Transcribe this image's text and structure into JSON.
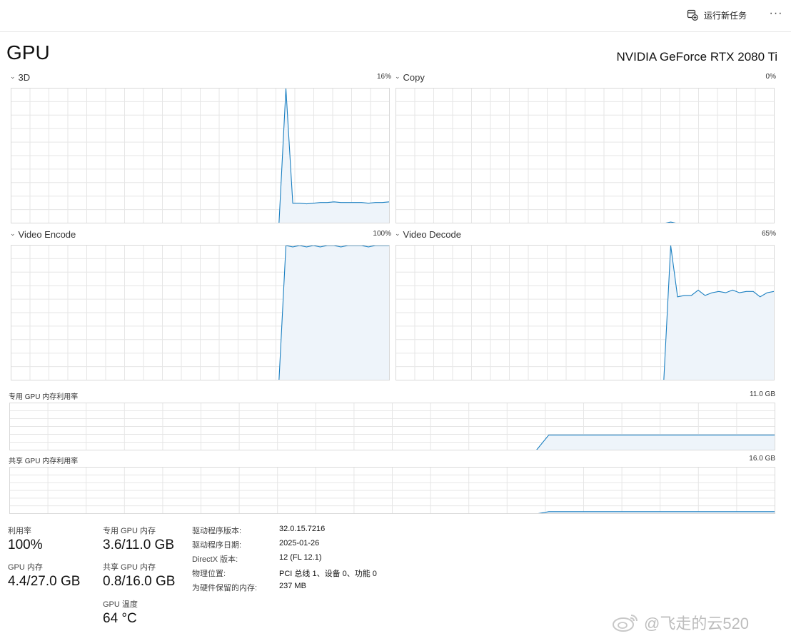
{
  "toolbar": {
    "run_task_label": "运行新任务",
    "run_task_icon": "run-task-icon",
    "more_icon": "more-icon",
    "more_glyph": "···"
  },
  "header": {
    "title": "GPU",
    "model": "NVIDIA GeForce RTX 2080 Ti"
  },
  "engines": [
    {
      "label": "3D",
      "percent": "16%"
    },
    {
      "label": "Copy",
      "percent": "0%"
    },
    {
      "label": "Video Encode",
      "percent": "100%"
    },
    {
      "label": "Video Decode",
      "percent": "65%"
    }
  ],
  "memory_graphs": [
    {
      "label": "专用 GPU 内存利用率",
      "max": "11.0 GB"
    },
    {
      "label": "共享 GPU 内存利用率",
      "max": "16.0 GB"
    }
  ],
  "stats": {
    "utilization_label": "利用率",
    "utilization_value": "100%",
    "gpu_memory_label": "GPU 内存",
    "gpu_memory_value": "4.4/27.0 GB",
    "dedicated_label": "专用 GPU 内存",
    "dedicated_value": "3.6/11.0 GB",
    "shared_label": "共享 GPU 内存",
    "shared_value": "0.8/16.0 GB",
    "temp_label": "GPU 温度",
    "temp_value": "64 °C"
  },
  "info": {
    "driver_version_key": "驱动程序版本:",
    "driver_version_val": "32.0.15.7216",
    "driver_date_key": "驱动程序日期:",
    "driver_date_val": "2025-01-26",
    "directx_key": "DirectX 版本:",
    "directx_val": "12 (FL 12.1)",
    "location_key": "物理位置:",
    "location_val": "PCI 总线 1、设备 0、功能 0",
    "reserved_key": "为硬件保留的内存:",
    "reserved_val": "237 MB"
  },
  "watermark": {
    "text": "@飞走的云520"
  },
  "colors": {
    "line": "#1a7fc1",
    "fill": "#eef4fa",
    "grid": "#e6e6e6"
  },
  "chart_data": [
    {
      "type": "area",
      "name_ref": "3D",
      "ylim": [
        0,
        100
      ],
      "values": [
        0,
        0,
        0,
        0,
        0,
        0,
        0,
        0,
        0,
        0,
        0,
        0,
        0,
        0,
        0,
        0,
        0,
        0,
        0,
        0,
        0,
        0,
        0,
        0,
        0,
        0,
        0,
        0,
        0,
        0,
        0,
        0,
        0,
        0,
        0,
        0,
        0,
        0,
        0,
        0,
        100,
        15,
        15,
        14.5,
        15,
        15.5,
        15.5,
        16,
        15.5,
        15.5,
        15.5,
        15.5,
        15,
        15.5,
        15.5,
        16
      ]
    },
    {
      "type": "area",
      "name_ref": "Copy",
      "ylim": [
        0,
        100
      ],
      "values": [
        0,
        0,
        0,
        0,
        0,
        0,
        0,
        0,
        0,
        0,
        0,
        0,
        0,
        0,
        0,
        0,
        0,
        0,
        0,
        0,
        0,
        0,
        0,
        0,
        0,
        0,
        0,
        0,
        0,
        0,
        0,
        0,
        0,
        0,
        0,
        0,
        0,
        0,
        0,
        0,
        1,
        0,
        0,
        0,
        0,
        0,
        0,
        0,
        0,
        0,
        0,
        0,
        0,
        0,
        0,
        0
      ]
    },
    {
      "type": "area",
      "name_ref": "Video Encode",
      "ylim": [
        0,
        100
      ],
      "values": [
        0,
        0,
        0,
        0,
        0,
        0,
        0,
        0,
        0,
        0,
        0,
        0,
        0,
        0,
        0,
        0,
        0,
        0,
        0,
        0,
        0,
        0,
        0,
        0,
        0,
        0,
        0,
        0,
        0,
        0,
        0,
        0,
        0,
        0,
        0,
        0,
        0,
        0,
        0,
        0,
        100,
        99,
        100,
        99,
        100,
        99,
        100,
        100,
        99,
        100,
        100,
        100,
        99,
        100,
        100,
        100
      ]
    },
    {
      "type": "area",
      "name_ref": "Video Decode",
      "ylim": [
        0,
        100
      ],
      "values": [
        0,
        0,
        0,
        0,
        0,
        0,
        0,
        0,
        0,
        0,
        0,
        0,
        0,
        0,
        0,
        0,
        0,
        0,
        0,
        0,
        0,
        0,
        0,
        0,
        0,
        0,
        0,
        0,
        0,
        0,
        0,
        0,
        0,
        0,
        0,
        0,
        0,
        0,
        0,
        0,
        100,
        62,
        63,
        63,
        67,
        63,
        65,
        66,
        65,
        67,
        65,
        66,
        66,
        62,
        65,
        66
      ]
    },
    {
      "type": "area",
      "name_ref": "专用 GPU 内存利用率",
      "ylim": [
        0,
        11
      ],
      "values": [
        0,
        0,
        0,
        0,
        0,
        0,
        0,
        0,
        0,
        0,
        0,
        0,
        0,
        0,
        0,
        0,
        0,
        0,
        0,
        0,
        0,
        0,
        0,
        0,
        0,
        0,
        0,
        0,
        0,
        0,
        0,
        0,
        0,
        0,
        0,
        0,
        0,
        0,
        0,
        0,
        0,
        0,
        0,
        3.6,
        3.6,
        3.6,
        3.6,
        3.6,
        3.6,
        3.6,
        3.6,
        3.6,
        3.6,
        3.6,
        3.6,
        3.6,
        3.6,
        3.6,
        3.6,
        3.6,
        3.6,
        3.6
      ]
    },
    {
      "type": "area",
      "name_ref": "共享 GPU 内存利用率",
      "ylim": [
        0,
        16
      ],
      "values": [
        0,
        0,
        0,
        0,
        0,
        0,
        0,
        0,
        0,
        0,
        0,
        0,
        0,
        0,
        0,
        0,
        0,
        0,
        0,
        0,
        0,
        0,
        0,
        0,
        0,
        0,
        0,
        0,
        0,
        0,
        0,
        0,
        0,
        0,
        0,
        0,
        0,
        0,
        0,
        0,
        0,
        0,
        0,
        0.8,
        0.8,
        0.8,
        0.8,
        0.8,
        0.8,
        0.8,
        0.8,
        0.8,
        0.8,
        0.8,
        0.8,
        0.8,
        0.8,
        0.8,
        0.8,
        0.8,
        0.8,
        0.8
      ]
    }
  ]
}
